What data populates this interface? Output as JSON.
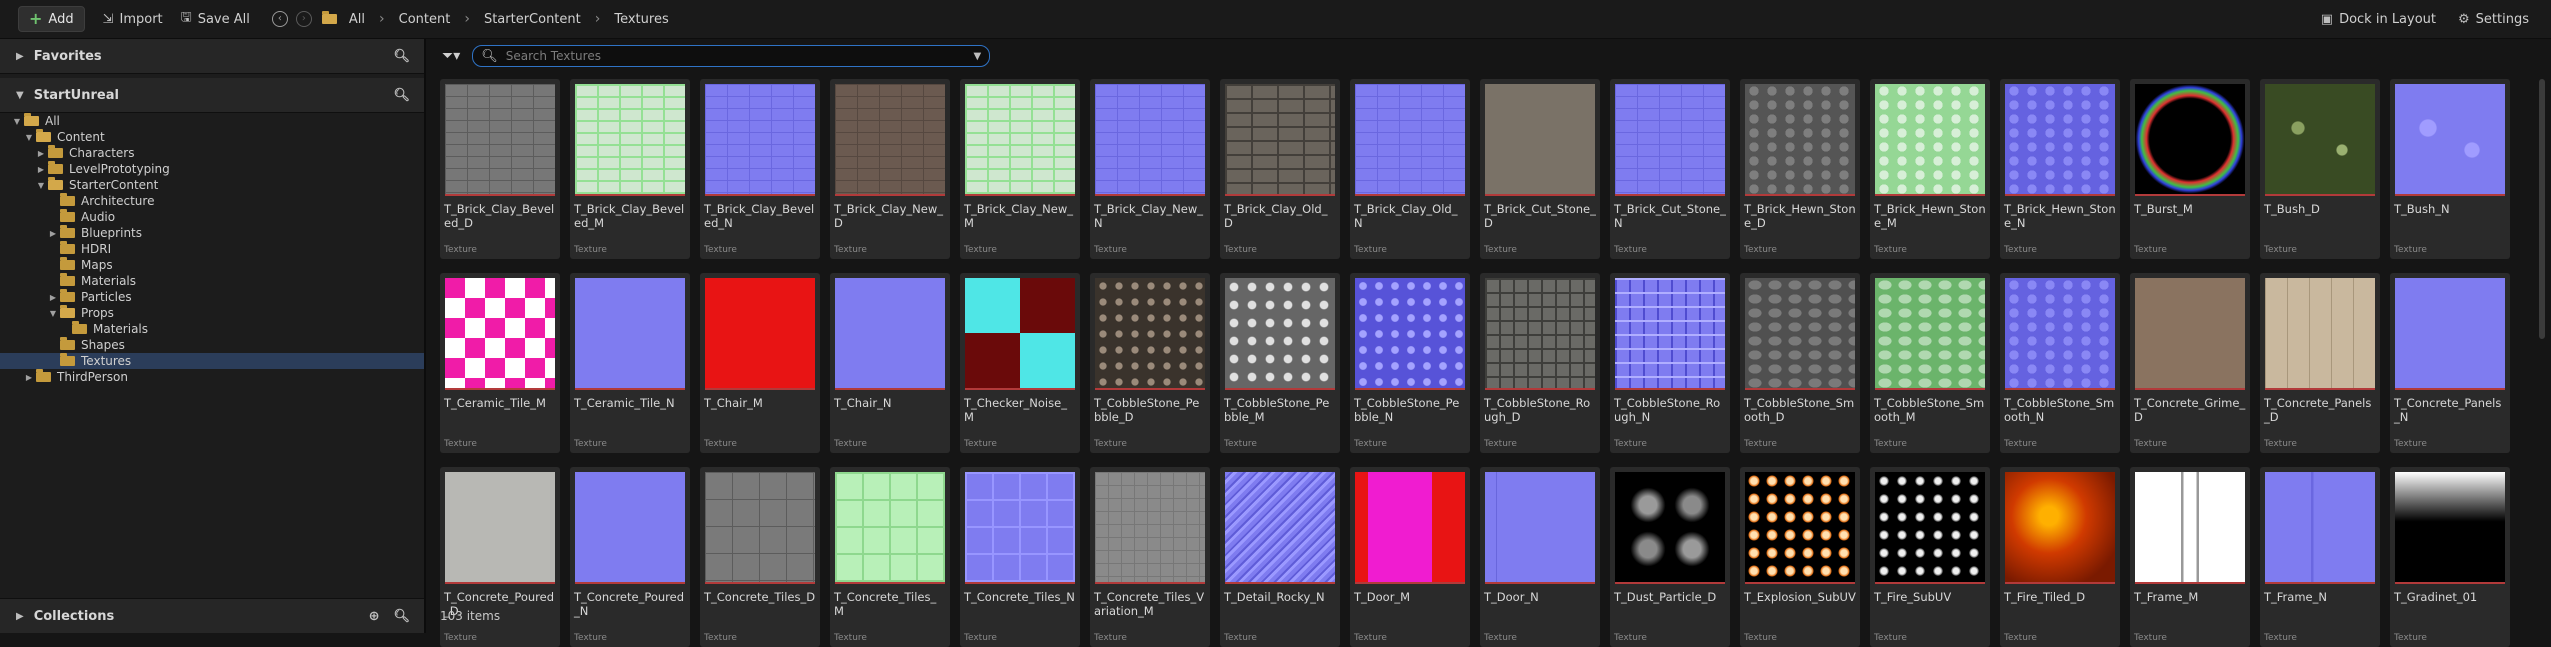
{
  "toolbar": {
    "add_label": "Add",
    "import_label": "Import",
    "save_all_label": "Save All",
    "breadcrumb": [
      "All",
      "Content",
      "StarterContent",
      "Textures"
    ],
    "dock_label": "Dock in Layout",
    "settings_label": "Settings"
  },
  "sidebar": {
    "favorites_label": "Favorites",
    "project_label": "StartUnreal",
    "collections_label": "Collections",
    "tree": [
      {
        "label": "All",
        "level": 0,
        "expanded": true
      },
      {
        "label": "Content",
        "level": 1,
        "expanded": true
      },
      {
        "label": "Characters",
        "level": 2,
        "expanded": false,
        "has_children": true
      },
      {
        "label": "LevelPrototyping",
        "level": 2,
        "expanded": false,
        "has_children": true
      },
      {
        "label": "StarterContent",
        "level": 2,
        "expanded": true
      },
      {
        "label": "Architecture",
        "level": 3
      },
      {
        "label": "Audio",
        "level": 3
      },
      {
        "label": "Blueprints",
        "level": 3,
        "has_children": true
      },
      {
        "label": "HDRI",
        "level": 3
      },
      {
        "label": "Maps",
        "level": 3
      },
      {
        "label": "Materials",
        "level": 3
      },
      {
        "label": "Particles",
        "level": 3,
        "has_children": true
      },
      {
        "label": "Props",
        "level": 3,
        "expanded": true
      },
      {
        "label": "Materials",
        "level": 4
      },
      {
        "label": "Shapes",
        "level": 3
      },
      {
        "label": "Textures",
        "level": 3,
        "selected": true
      },
      {
        "label": "ThirdPerson",
        "level": 1,
        "has_children": true
      }
    ]
  },
  "search": {
    "placeholder": "Search Textures",
    "value": ""
  },
  "assets": [
    {
      "name": "T_Brick_Clay_Beveled_D",
      "type": "Texture",
      "style": "p-brick"
    },
    {
      "name": "T_Brick_Clay_Beveled_M",
      "type": "Texture",
      "style": "p-brickm"
    },
    {
      "name": "T_Brick_Clay_Beveled_N",
      "type": "Texture",
      "style": "p-normal"
    },
    {
      "name": "T_Brick_Clay_New_D",
      "type": "Texture",
      "style": "p-brown"
    },
    {
      "name": "T_Brick_Clay_New_M",
      "type": "Texture",
      "style": "p-brickm"
    },
    {
      "name": "T_Brick_Clay_New_N",
      "type": "Texture",
      "style": "p-normal"
    },
    {
      "name": "T_Brick_Clay_Old_D",
      "type": "Texture",
      "style": "p-old"
    },
    {
      "name": "T_Brick_Clay_Old_N",
      "type": "Texture",
      "style": "p-normal"
    },
    {
      "name": "T_Brick_Cut_Stone_D",
      "type": "Texture",
      "style": "p-stone"
    },
    {
      "name": "T_Brick_Cut_Stone_N",
      "type": "Texture",
      "style": "p-normal"
    },
    {
      "name": "T_Brick_Hewn_Stone_D",
      "type": "Texture",
      "style": "p-hewn"
    },
    {
      "name": "T_Brick_Hewn_Stone_M",
      "type": "Texture",
      "style": "p-hewnm"
    },
    {
      "name": "T_Brick_Hewn_Stone_N",
      "type": "Texture",
      "style": "p-hewnn"
    },
    {
      "name": "T_Burst_M",
      "type": "Texture",
      "style": "p-burst"
    },
    {
      "name": "T_Bush_D",
      "type": "Texture",
      "style": "p-bush"
    },
    {
      "name": "T_Bush_N",
      "type": "Texture",
      "style": "p-bushn"
    },
    {
      "name": "T_Ceramic_Tile_M",
      "type": "Texture",
      "style": "p-ceramic"
    },
    {
      "name": "T_Ceramic_Tile_N",
      "type": "Texture",
      "style": "p-normalplain"
    },
    {
      "name": "T_Chair_M",
      "type": "Texture",
      "style": "p-chair"
    },
    {
      "name": "T_Chair_N",
      "type": "Texture",
      "style": "p-normalplain"
    },
    {
      "name": "T_Checker_Noise_M",
      "type": "Texture",
      "style": "p-checker"
    },
    {
      "name": "T_CobbleStone_Pebble_D",
      "type": "Texture",
      "style": "p-pebble"
    },
    {
      "name": "T_CobbleStone_Pebble_M",
      "type": "Texture",
      "style": "p-pebblem"
    },
    {
      "name": "T_CobbleStone_Pebble_N",
      "type": "Texture",
      "style": "p-pebblen"
    },
    {
      "name": "T_CobbleStone_Rough_D",
      "type": "Texture",
      "style": "p-rough"
    },
    {
      "name": "T_CobbleStone_Rough_N",
      "type": "Texture",
      "style": "p-roughn"
    },
    {
      "name": "T_CobbleStone_Smooth_D",
      "type": "Texture",
      "style": "p-smooth"
    },
    {
      "name": "T_CobbleStone_Smooth_M",
      "type": "Texture",
      "style": "p-smoothm"
    },
    {
      "name": "T_CobbleStone_Smooth_N",
      "type": "Texture",
      "style": "p-hewnn"
    },
    {
      "name": "T_Concrete_Grime_D",
      "type": "Texture",
      "style": "p-grime"
    },
    {
      "name": "T_Concrete_Panels_D",
      "type": "Texture",
      "style": "p-panels"
    },
    {
      "name": "T_Concrete_Panels_N",
      "type": "Texture",
      "style": "p-normalplain"
    },
    {
      "name": "T_Concrete_Poured_D",
      "type": "Texture",
      "style": "p-poured"
    },
    {
      "name": "T_Concrete_Poured_N",
      "type": "Texture",
      "style": "p-normalplain"
    },
    {
      "name": "T_Concrete_Tiles_D",
      "type": "Texture",
      "style": "p-tiles"
    },
    {
      "name": "T_Concrete_Tiles_M",
      "type": "Texture",
      "style": "p-tilesm"
    },
    {
      "name": "T_Concrete_Tiles_N",
      "type": "Texture",
      "style": "p-tilesn"
    },
    {
      "name": "T_Concrete_Tiles_Variation_M",
      "type": "Texture",
      "style": "p-tilesvar"
    },
    {
      "name": "T_Detail_Rocky_N",
      "type": "Texture",
      "style": "p-rocky"
    },
    {
      "name": "T_Door_M",
      "type": "Texture",
      "style": "p-door"
    },
    {
      "name": "T_Door_N",
      "type": "Texture",
      "style": "p-doorn"
    },
    {
      "name": "T_Dust_Particle_D",
      "type": "Texture",
      "style": "p-dust"
    },
    {
      "name": "T_Explosion_SubUV",
      "type": "Texture",
      "style": "p-explosion"
    },
    {
      "name": "T_Fire_SubUV",
      "type": "Texture",
      "style": "p-firesub"
    },
    {
      "name": "T_Fire_Tiled_D",
      "type": "Texture",
      "style": "p-fire"
    },
    {
      "name": "T_Frame_M",
      "type": "Texture",
      "style": "p-frame"
    },
    {
      "name": "T_Frame_N",
      "type": "Texture",
      "style": "p-framen"
    },
    {
      "name": "T_Gradinet_01",
      "type": "Texture",
      "style": "p-gradinet"
    }
  ],
  "status": {
    "item_count": "103 items"
  }
}
